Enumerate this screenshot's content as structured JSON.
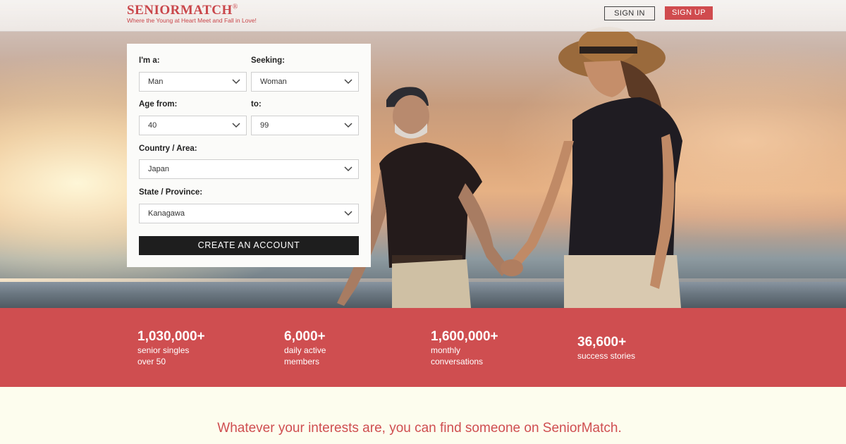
{
  "header": {
    "logo_text": "SENIORMATCH",
    "logo_mark": "®",
    "tagline": "Where the Young at Heart Meet and Fall in Love!",
    "sign_in_label": "SIGN IN",
    "sign_up_label": "SIGN UP"
  },
  "form": {
    "im_a": {
      "label": "I'm a:",
      "value": "Man"
    },
    "seeking": {
      "label": "Seeking:",
      "value": "Woman"
    },
    "age_from": {
      "label": "Age from:",
      "value": "40"
    },
    "age_to": {
      "label": "to:",
      "value": "99"
    },
    "country": {
      "label": "Country / Area:",
      "value": "Japan"
    },
    "state": {
      "label": "State / Province:",
      "value": "Kanagawa"
    },
    "submit_label": "CREATE AN ACCOUNT"
  },
  "stats": [
    {
      "number": "1,030,000+",
      "line1": "senior singles",
      "line2": "over 50"
    },
    {
      "number": "6,000+",
      "line1": "daily active",
      "line2": "members"
    },
    {
      "number": "1,600,000+",
      "line1": "monthly",
      "line2": "conversations"
    },
    {
      "number": "36,600+",
      "line1": "success stories",
      "line2": ""
    }
  ],
  "bottom": {
    "headline": "Whatever your interests are, you can find someone on SeniorMatch."
  },
  "colors": {
    "brand_red": "#cf4e50",
    "button_dark": "#1e1e1e",
    "cream": "#fdfdee"
  }
}
